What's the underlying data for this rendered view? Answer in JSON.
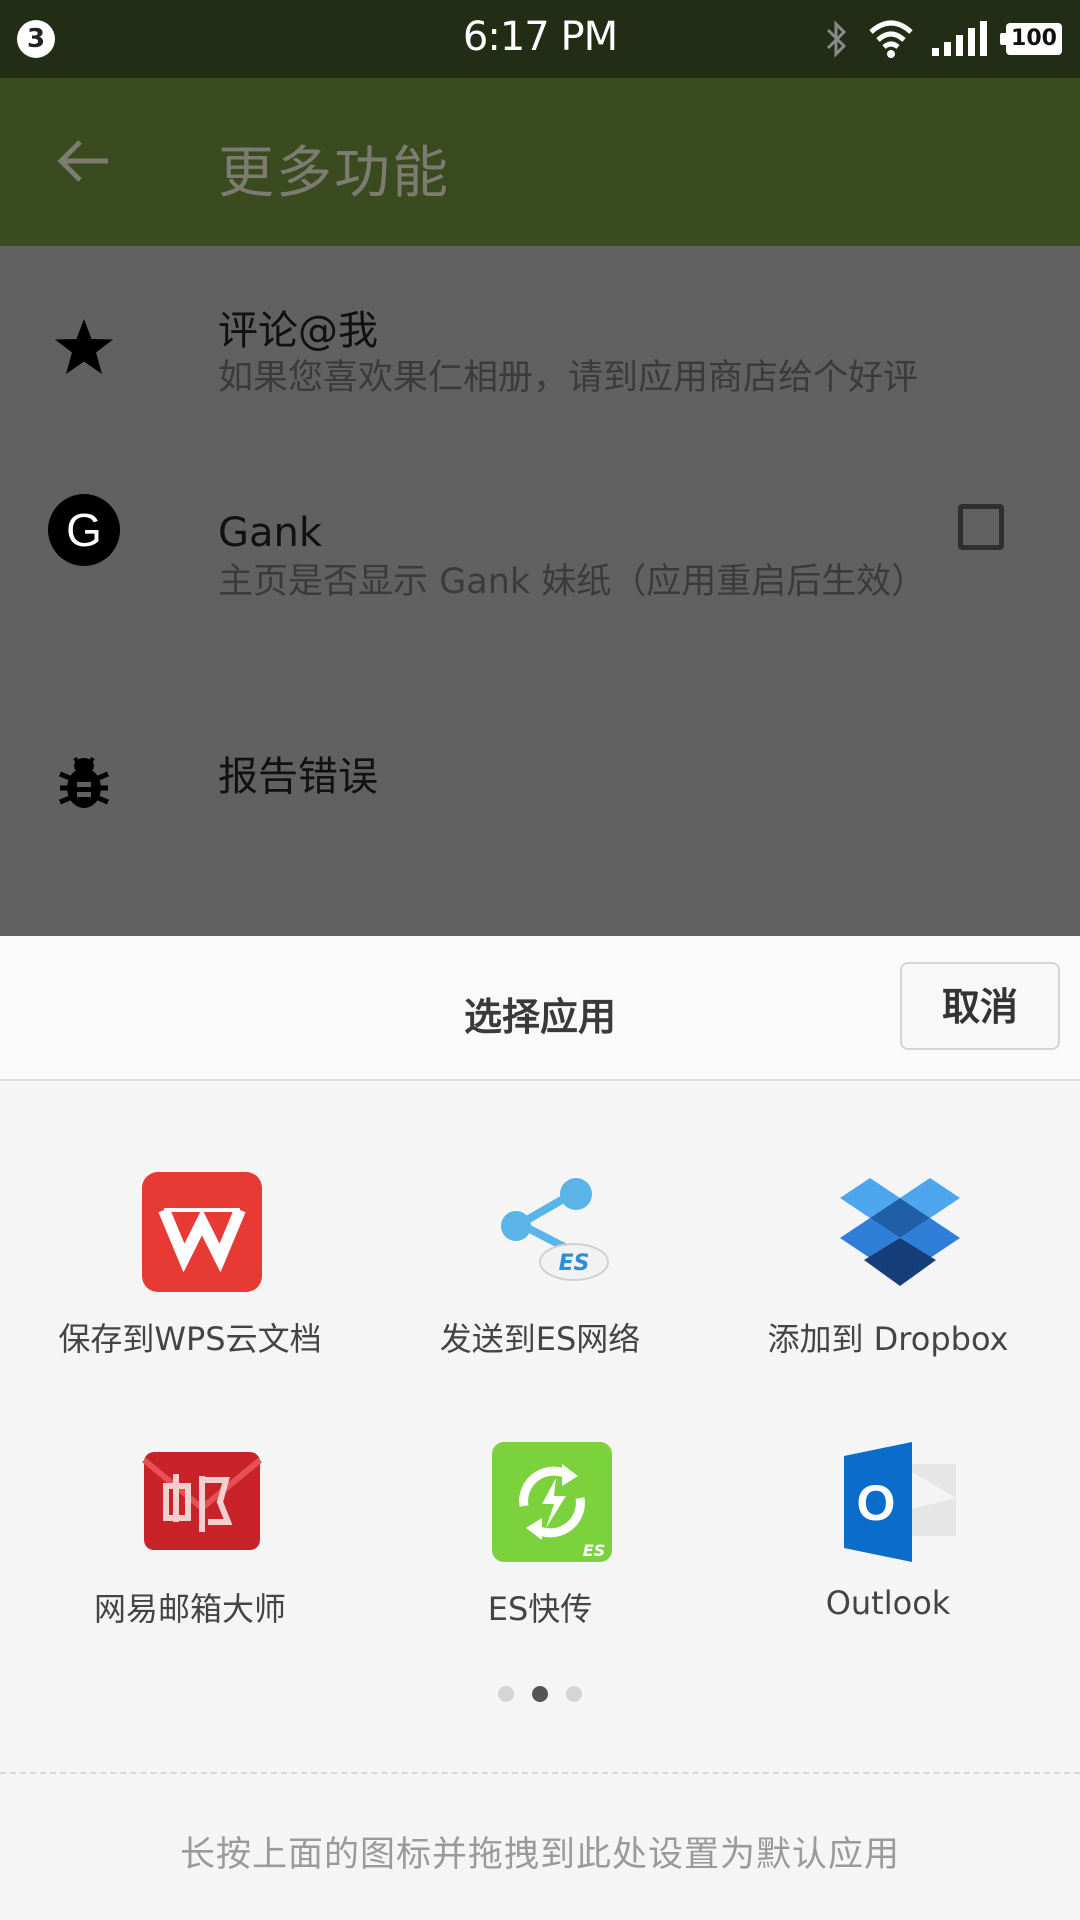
{
  "status_bar": {
    "notification_count": "3",
    "time": "6:17 PM",
    "battery": "100",
    "icons": [
      "bluetooth-icon",
      "wifi-icon",
      "signal-icon",
      "battery-icon"
    ]
  },
  "app_bar": {
    "title": "更多功能",
    "back_icon": "arrow-left-icon"
  },
  "settings": [
    {
      "icon": "star-icon",
      "title": "评论@我",
      "subtitle": "如果您喜欢果仁相册，请到应用商店给个好评"
    },
    {
      "icon": "g-icon",
      "icon_text": "G",
      "title": "Gank",
      "subtitle": "主页是否显示 Gank 妹纸（应用重启后生效）",
      "checked": false
    },
    {
      "icon": "bug-icon",
      "title": "报告错误"
    }
  ],
  "share_sheet": {
    "title": "选择应用",
    "cancel_label": "取消",
    "apps": [
      {
        "label": "保存到WPS云文档",
        "icon": "wps-icon"
      },
      {
        "label": "发送到ES网络",
        "icon": "es-share-icon",
        "icon_text": "ES"
      },
      {
        "label": "添加到 Dropbox",
        "icon": "dropbox-icon"
      },
      {
        "label": "网易邮箱大师",
        "icon": "netease-mail-icon"
      },
      {
        "label": "ES快传",
        "icon": "es-transfer-icon",
        "icon_text": "ES"
      },
      {
        "label": "Outlook",
        "icon": "outlook-icon",
        "icon_text": "O"
      }
    ],
    "pagination": {
      "pages": 3,
      "current": 2
    },
    "footer_hint": "长按上面的图标并拖拽到此处设置为默认应用"
  },
  "colors": {
    "status_bar": "#232d16",
    "app_bar": "#3a4b20",
    "dim_overlay": "#616161",
    "sheet_bg": "#f5f5f5",
    "wps_red": "#e83a35",
    "es_green": "#7bd23c",
    "dropbox_blue": "#2f7fd8",
    "outlook_blue": "#0a6dc9"
  }
}
